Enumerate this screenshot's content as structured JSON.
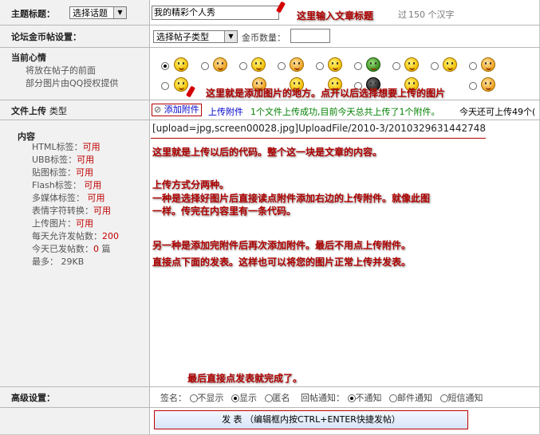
{
  "topic": {
    "label": "主题标题：",
    "select_value": "选择话题",
    "title_value": "我的精彩个人秀",
    "limit_prefix": "过",
    "limit_text": "150 个汉字",
    "annotation": "这里输入文章标题"
  },
  "coins": {
    "label": "论坛金币帖设置：",
    "select_value": "选择帖子类型",
    "amount_label": "金币数量："
  },
  "mood": {
    "label": "当前心情",
    "line1": "将放在帖子的前面",
    "line2": "部分图片由QQ授权提供",
    "annotation": "这里就是添加图片的地方。点开以后选择想要上传的图片"
  },
  "upload": {
    "label": "文件上传",
    "label_suffix": "类型",
    "add_link": "添加附件",
    "upload_link": "上传附件",
    "status": "1个文件上传成功,目前今天总共上传了1个附件。",
    "remain": "今天还可上传49个("
  },
  "content": {
    "label": "内容",
    "options": [
      {
        "name": "HTML标签：",
        "value": "可用"
      },
      {
        "name": "UBB标签：",
        "value": "可用"
      },
      {
        "name": "贴图标签：",
        "value": "可用"
      },
      {
        "name": "Flash标签：",
        "value": "可用"
      },
      {
        "name": "多媒体标签：",
        "value": "可用"
      },
      {
        "name": "表情字符转换：",
        "value": "可用"
      },
      {
        "name": "上传图片：",
        "value": "可用"
      }
    ],
    "daily_limit_label": "每天允许发帖数：",
    "daily_limit_value": "200",
    "today_label": "今天已发帖数：",
    "today_value": "0",
    "today_unit": "篇",
    "max_label": "最多：",
    "max_value": "29KB",
    "editor_code": "[upload=jpg,screen00028.jpg]UploadFile/2010-3/2010329631442748",
    "annotations": [
      "这里就是上传以后的代码。整个这一块是文章的内容。",
      "上传方式分两种。",
      "一种是选择好图片后直接读点附件添加右边的上传附件。就像此图",
      "一样。传完在内容里有一条代码。",
      "另一种是添加完附件后再次添加附件。最后不用点上传附件。",
      "直接点下面的发表。这样也可以将您的图片正常上传并发表。"
    ],
    "final_annotation": "最后直接点发表就完成了。"
  },
  "advanced": {
    "label": "高级设置：",
    "sign_label": "签名：",
    "sign_options": [
      "不显示",
      "显示",
      "匿名"
    ],
    "reply_label": "回帖通知：",
    "reply_options": [
      "不通知",
      "邮件通知",
      "短信通知"
    ]
  },
  "submit": {
    "label": "发 表 （编辑框内按CTRL+ENTER快捷发帖）"
  },
  "colors": {
    "value_red": "#c00000",
    "link_blue": "#0000cc",
    "status_green": "#008000",
    "annotation_red": "#b00000"
  }
}
